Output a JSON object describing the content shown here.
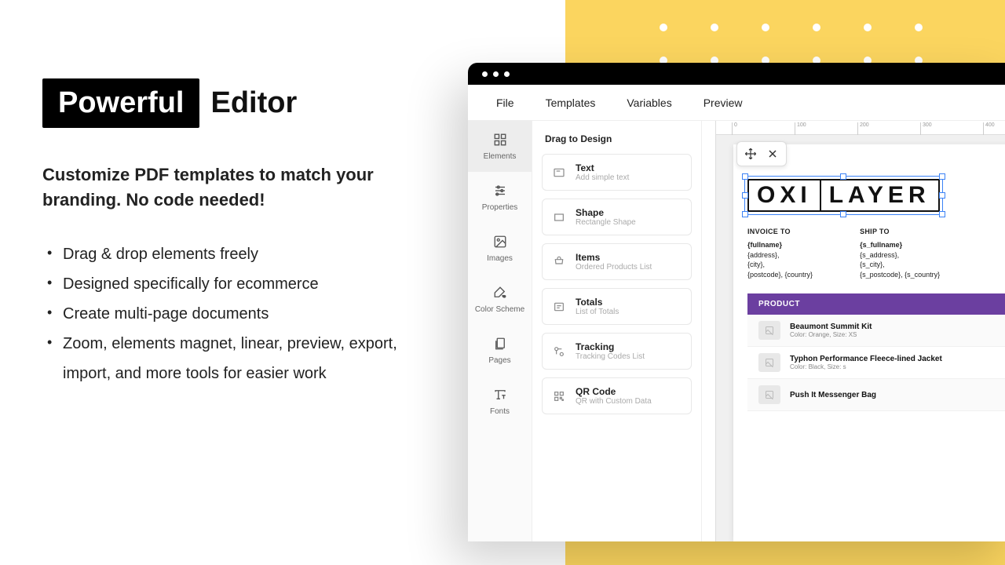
{
  "hero": {
    "badge": "Powerful",
    "title": "Editor",
    "subtitle": "Customize PDF templates to match your branding. No code needed!",
    "bullets": [
      "Drag & drop elements freely",
      "Designed specifically for ecommerce",
      "Create multi-page documents",
      "Zoom, elements magnet, linear, preview, export, import, and more tools for easier work"
    ]
  },
  "menubar": [
    "File",
    "Templates",
    "Variables",
    "Preview"
  ],
  "sidebar": [
    {
      "label": "Elements",
      "icon": "grid"
    },
    {
      "label": "Properties",
      "icon": "sliders"
    },
    {
      "label": "Images",
      "icon": "image"
    },
    {
      "label": "Color Scheme",
      "icon": "paint"
    },
    {
      "label": "Pages",
      "icon": "pages"
    },
    {
      "label": "Fonts",
      "icon": "font"
    }
  ],
  "drag": {
    "title": "Drag to Design",
    "items": [
      {
        "name": "Text",
        "desc": "Add simple text"
      },
      {
        "name": "Shape",
        "desc": "Rectangle Shape"
      },
      {
        "name": "Items",
        "desc": "Ordered Products List"
      },
      {
        "name": "Totals",
        "desc": "List of Totals"
      },
      {
        "name": "Tracking",
        "desc": "Tracking Codes List"
      },
      {
        "name": "QR Code",
        "desc": "QR with Custom Data"
      }
    ]
  },
  "canvas": {
    "logo": {
      "a": "OXI",
      "b": "LAYER"
    },
    "invoice": {
      "heading": "INVOICE TO",
      "lines": [
        "{fullname}",
        "{address},",
        "{city},",
        "{postcode}, {country}"
      ]
    },
    "ship": {
      "heading": "SHIP TO",
      "lines": [
        "{s_fullname}",
        "{s_address},",
        "{s_city},",
        "{s_postcode}, {s_country}"
      ]
    },
    "table": {
      "header": "PRODUCT",
      "rows": [
        {
          "name": "Beaumont Summit Kit",
          "meta": "Color: Orange, Size: XS"
        },
        {
          "name": "Typhon Performance Fleece-lined Jacket",
          "meta": "Color: Black, Size: s"
        },
        {
          "name": "Push It Messenger Bag",
          "meta": ""
        }
      ]
    }
  }
}
